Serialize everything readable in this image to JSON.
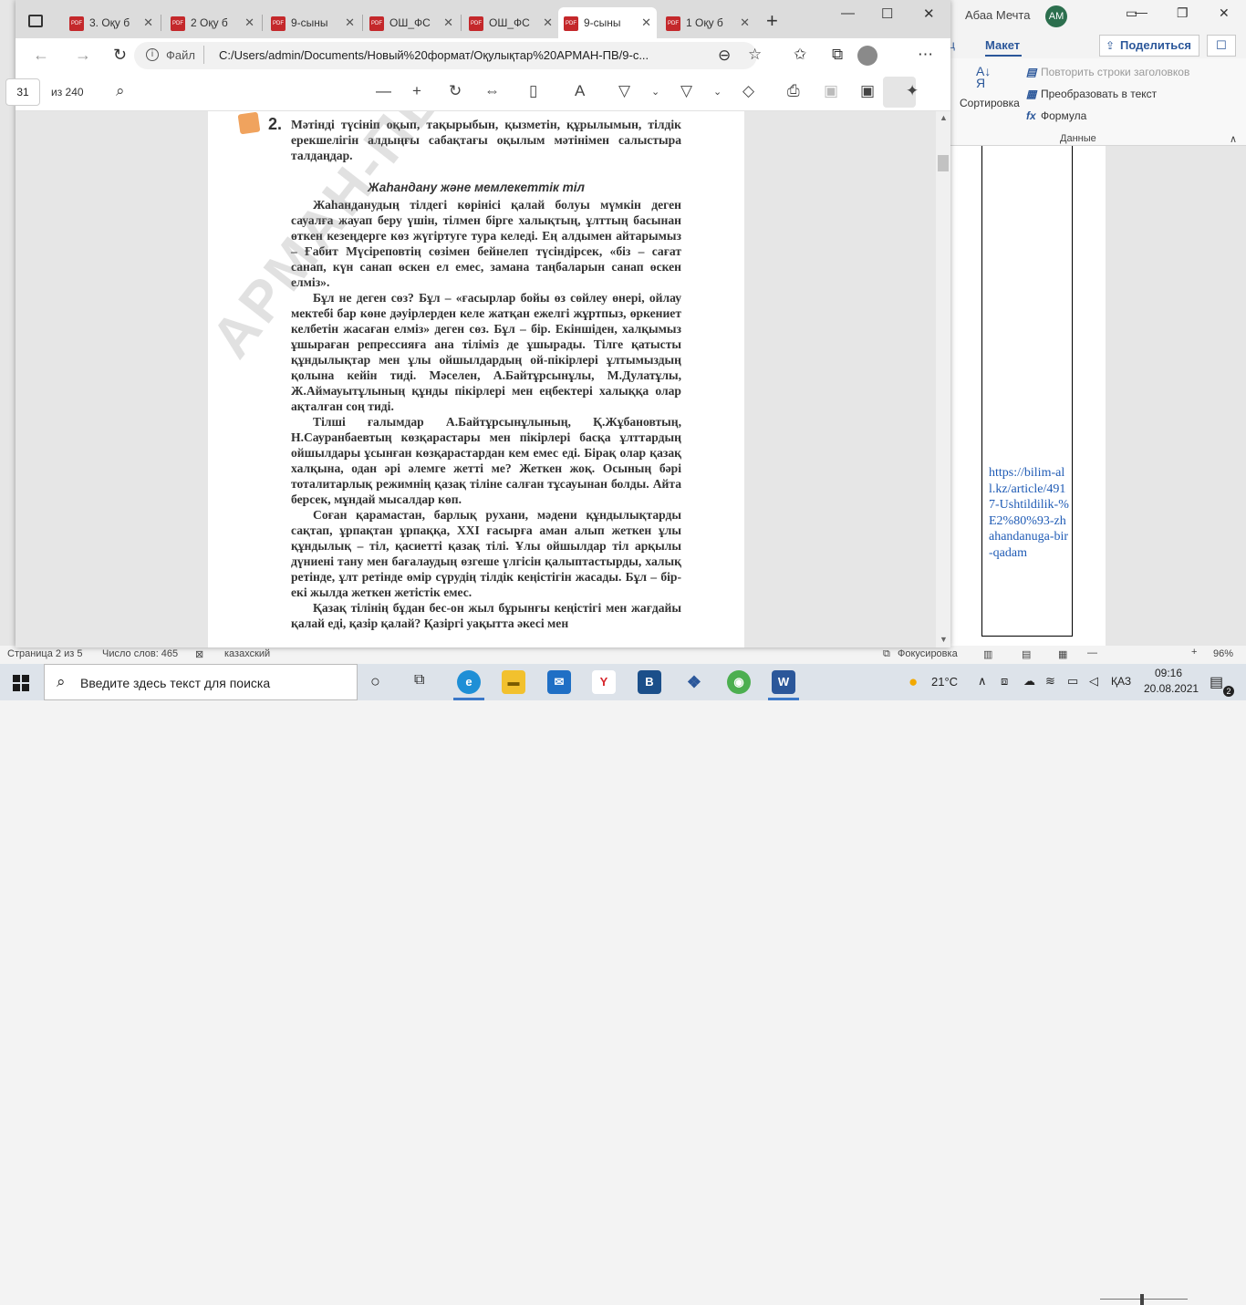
{
  "word": {
    "user_name": "Абаа Мечта",
    "avatar_initials": "АМ",
    "tab_cut": "ц",
    "active_tab": "Макет",
    "share_label": "Поделиться",
    "ribbon": {
      "sort_label": "Сортировка",
      "repeat_header_rows": "Повторить строки заголовков",
      "convert_to_text": "Преобразовать в текст",
      "formula": "Формула",
      "group_label": "Данные"
    },
    "link_text": "https://bilim-all.kz/article/4917-Ushtildilik-%E2%80%93-zhahandanuga-bir-qadam",
    "status": {
      "page": "Страница 2 из 5",
      "words": "Число слов: 465",
      "language": "казахский",
      "focus": "Фокусировка",
      "zoom": "96%"
    }
  },
  "edge": {
    "tabs": [
      {
        "label": "3. Оқу б",
        "active": false
      },
      {
        "label": "2 Оқу б",
        "active": false
      },
      {
        "label": "9-сыны",
        "active": false
      },
      {
        "label": "ОШ_ФС",
        "active": false
      },
      {
        "label": "ОШ_ФС",
        "active": false
      },
      {
        "label": "9-сыны",
        "active": true
      },
      {
        "label": "1 Оқу б",
        "active": false
      }
    ],
    "url_scheme_label": "Файл",
    "url": "C:/Users/admin/Documents/Новый%20формат/Оқулықтар%20АРМАН-ПВ/9-с...",
    "pdf_toolbar": {
      "current_page": "31",
      "total_pages": "из 240"
    }
  },
  "pdf": {
    "task_number": "2.",
    "task_text": "Мәтінді түсініп оқып, тақырыбын, қызметін, құрылымын, тілдік ерекшелігін алдыңғы сабақтағы оқылым мәтінімен салыстыра талдаңдар.",
    "title": "Жаһандану және мемлекеттік тіл",
    "paragraphs": [
      "Жаһанданудың тілдегі көрінісі қалай болуы мүмкін деген сауалға жауап беру үшін, тілмен бірге халықтың, ұлттың басынан өткен кезеңдерге көз жүгіртуге тура келеді. Ең алдымен айтарымыз – Ғабит Мүсіреповтің сөзімен бейнелеп түсіндірсек, «біз – сағат санап, күн санап өскен ел емес, замана таңбаларын санап өскен елміз».",
      "Бұл не деген сөз? Бұл – «ғасырлар бойы өз сөйлеу өнері, ойлау мектебі бар көне дәуірлерден келе жатқан ежелгі жұртпыз, өркениет келбетін жасаған елміз» деген сөз. Бұл – бір. Екіншіден, халқымыз ұшыраған репрессияға ана тіліміз де ұшырады. Тілге қатысты құндылықтар мен ұлы ойшылдардың ой-пікірлері ұлтымыздың қолына кейін тиді. Мәселен, А.Байтұрсынұлы, М.Дулатұлы, Ж.Аймауытұлының құнды пікірлері мен еңбектері халыққа олар ақталған соң тиді.",
      "Тілші ғалымдар А.Байтұрсынұлының, Қ.Жұбановтың, Н.Сауранбаевтың көзқарастары мен пікірлері басқа ұлттардың ойшылдары ұсынған көзқарастардан кем емес еді. Бірақ олар қазақ халқына, одан әрі әлемге жетті ме? Жеткен жоқ. Осының бәрі тоталитарлық режимнің қазақ тіліне салған тұсауынан болды. Айта берсек, мұндай мысалдар көп.",
      "Соған қарамастан, барлық рухани, мәдени құндылықтарды сақтап, ұрпақтан ұрпаққа, XXI ғасырға аман алып жеткен ұлы құндылық – тіл, қасиетті қазақ тілі. Ұлы ойшылдар тіл арқылы дүниені тану мен бағалаудың өзгеше үлгісін қалыптастырды, халық ретінде, ұлт ретінде өмір сүрудің тілдік кеңістігін жасады. Бұл – бір-екі жылда жеткен жетістік емес.",
      "Қазақ тілінің бұдан бес-он жыл бұрынғы кеңістігі мен жағдайы қалай еді, қазір қалай? Қазіргі уақытта әкесі мен"
    ],
    "watermark": "АРМАН-ПВ баспа"
  },
  "taskbar": {
    "search_placeholder": "Введите здесь текст для поиска",
    "weather": "21°C",
    "language": "ҚАЗ",
    "time": "09:16",
    "date": "20.08.2021",
    "notification_count": "2"
  }
}
